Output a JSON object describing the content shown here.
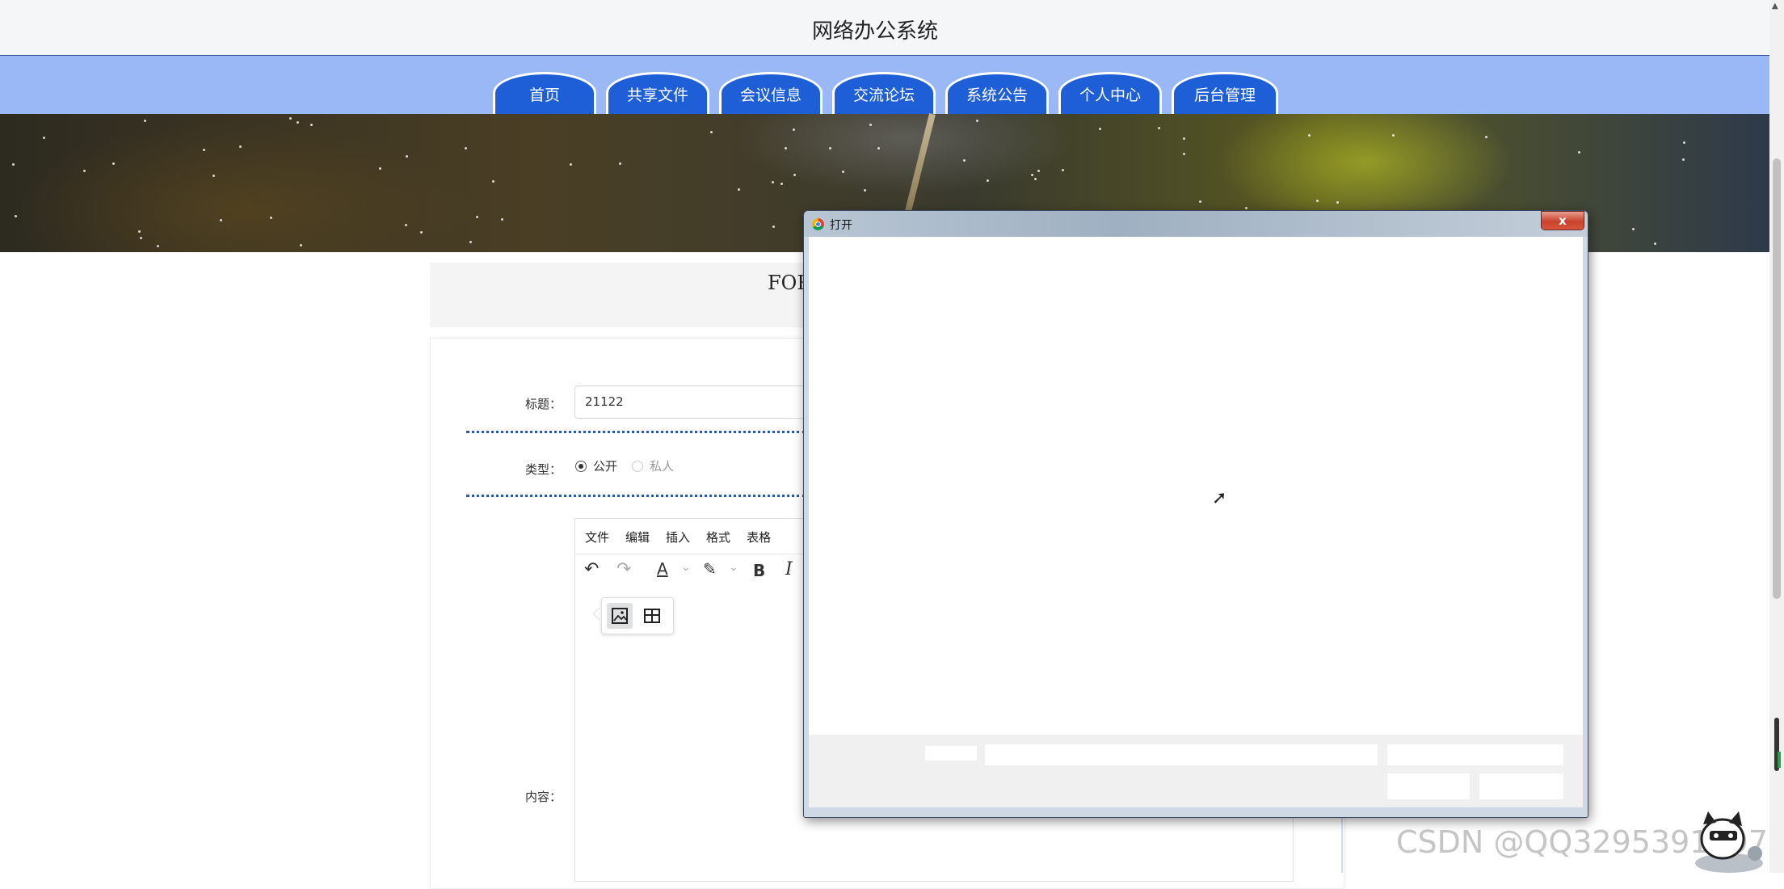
{
  "site": {
    "title": "网络办公系统"
  },
  "nav": {
    "tabs": [
      {
        "label": "首页"
      },
      {
        "label": "共享文件"
      },
      {
        "label": "会议信息"
      },
      {
        "label": "交流论坛"
      },
      {
        "label": "系统公告"
      },
      {
        "label": "个人中心"
      },
      {
        "label": "后台管理"
      }
    ]
  },
  "form": {
    "heading_partial": "FOR",
    "title_label": "标题：",
    "title_value": "21122",
    "type_label": "类型：",
    "type_options": [
      {
        "label": "公开",
        "selected": true
      },
      {
        "label": "私人",
        "selected": false
      }
    ],
    "content_label": "内容："
  },
  "editor": {
    "menu": [
      "文件",
      "编辑",
      "插入",
      "格式",
      "表格"
    ],
    "tools": [
      "undo-icon",
      "redo-icon",
      "text-color-icon",
      "highlight-icon",
      "bold-icon",
      "italic-icon"
    ],
    "bold_glyph": "B",
    "italic_glyph": "I",
    "text_color_glyph": "A",
    "quick_insert": [
      "image-icon",
      "table-icon"
    ]
  },
  "dialog": {
    "title": "打开",
    "close_glyph": "x"
  },
  "watermark": "CSDN @QQ3295391197",
  "colors": {
    "nav_bg": "#9bb8f6",
    "tab_bg": "#1e5fd8",
    "dotted_divider": "#2d58a8"
  }
}
